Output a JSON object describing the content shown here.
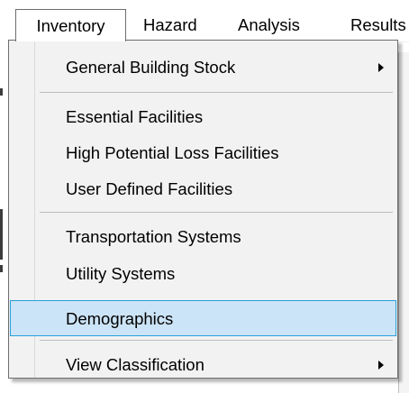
{
  "menubar": {
    "items": [
      {
        "label": "Inventory"
      },
      {
        "label": "Hazard"
      },
      {
        "label": "Analysis"
      },
      {
        "label": "Results"
      }
    ]
  },
  "dropdown": {
    "items": [
      {
        "label": "General Building Stock",
        "submenu_icon": "chevron-right-icon"
      },
      {
        "label": "Essential Facilities"
      },
      {
        "label": "High Potential Loss Facilities"
      },
      {
        "label": "User Defined Facilities"
      },
      {
        "label": "Transportation Systems"
      },
      {
        "label": "Utility Systems"
      },
      {
        "label": "Demographics",
        "state": "highlighted"
      },
      {
        "label": "View Classification",
        "submenu_icon": "chevron-right-icon"
      }
    ]
  },
  "colors": {
    "menu_background": "#f2f2f2",
    "highlight_fill": "#cce4f7",
    "highlight_border": "#26a0da"
  }
}
